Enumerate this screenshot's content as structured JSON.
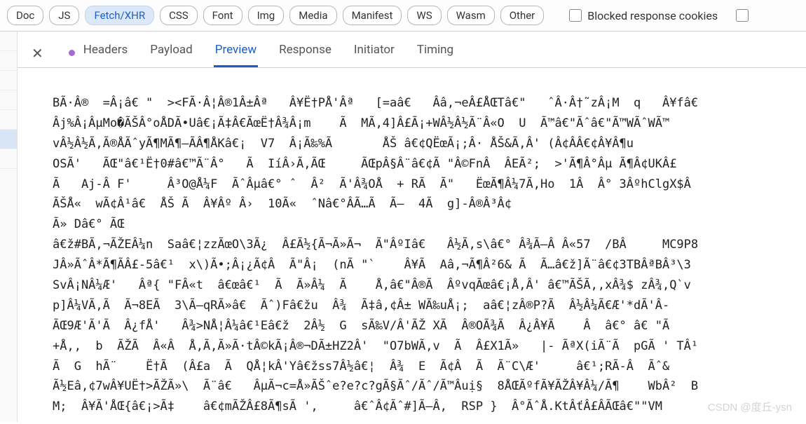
{
  "filters": {
    "items": [
      {
        "label": "Doc",
        "active": false
      },
      {
        "label": "JS",
        "active": false
      },
      {
        "label": "Fetch/XHR",
        "active": true
      },
      {
        "label": "CSS",
        "active": false
      },
      {
        "label": "Font",
        "active": false
      },
      {
        "label": "Img",
        "active": false
      },
      {
        "label": "Media",
        "active": false
      },
      {
        "label": "Manifest",
        "active": false
      },
      {
        "label": "WS",
        "active": false
      },
      {
        "label": "Wasm",
        "active": false
      },
      {
        "label": "Other",
        "active": false
      }
    ],
    "blocked_cookies_label": "Blocked response cookies"
  },
  "tabs": {
    "items": [
      {
        "label": "Headers",
        "active": false
      },
      {
        "label": "Payload",
        "active": false
      },
      {
        "label": "Preview",
        "active": true
      },
      {
        "label": "Response",
        "active": false
      },
      {
        "label": "Initiator",
        "active": false
      },
      {
        "label": "Timing",
        "active": false
      }
    ]
  },
  "preview": {
    "lines": [
      "BÃ·Â®  =Â¡â€ \"  ><FÃ·Â¦Â®1Â±Âª   Â¥Ë†PÅ'Âª   [=aâ€   Ââ,¬eÂ£ÅŒTâ€\"   ˆÂ·Â†˜zÂ¡M  q   Â¥fâ€",
      "Âj%Â¡ÂµMo�ÃŠÂ°oÅDÃ•Uâ€¡Ã‡Â€ÃœË†Â¾Â¡m    Ã  MÃ,4]Â£Ã¡+WÂ½Â½Ã¨Â«O  U  Ã™â€\"Ãˆâ€\"Ã™WÃˆWÃ™",
      "vÂ½Â½Ã,Ã®ÅÃˆyÃ¶MÃ¶–ÃÂ¶ÅKâ€¡  V7  Â¡Ã‰%Ã       ÅŠ â€¢QËœÃ¡;Â· ÅŠ&Ã,Â' (Â¢ÂÂ€¢Â¥Â¶u",
      "OSÃ'   ÃŒ\"â€¹Ë†0#â€™Ã¨Â°   Ã  IíÂ›Ã,ÃŒ     ÃŒpÂ§Â¨â€¢Ã \"Â©FnÂ  ÂEÃ²;  >'Ã¶Â°Âµ Ã¶Â¢UKÂ£",
      "Ã   Aj-Â F'     Â³O@Å¼F  ÃˆÂµâ€° ˆ  Â²  Ã'Â¾OÅ  + RÃ  Ã\"   ËœÃ¶Â¼7Ã,Ho  1Â  Â° 3ÂºhClgX$Â",
      "ÃŠÅ«  wÃ¢Â¹â€  ÅŠ Ã  Â¥Âº Â›  10Ã«  ˆNâ€°ÂÃ…Ã  Ã—  4Ã  g]-Â®Â³Â¢",
      "Ã» Dâ€° ÃŒ",
      "â€ž#BÃ,¬ÃŽEÂ¼n  Saâ€¦zzÃœO\\3Ã¿  Â£Ã½{Ã¬Ã»Ã¬  Ã\"ÂºIâ€   Â½Ã,s\\â€° Â¾Ã—Â Â«57  /BÂ     MC9P8",
      "JÂ»ÃˆÂ*Ã¶ÃÂ£-5â€¹  x\\)Ã•;Â¡¿Ã¢Â  Ã\"Â¡  (nÃ \"`    Â¥Ã  Aâ,¬Ã¶Â²6& Ã  Ã…â€ž]Ã¨â€¢3TBÂªBÂ³\\3",
      "SvÂ¡NÂ¼Æ'   Âª{ \"FÂ«t  â€œâ€¹  Ã  Ã»Â¼  Ã    Å,â€\"Â®Ã  ÂºvqÃœâ€¡Å,Â' â€™ÃŠÃ,,xÂ¾$ zÂ¾,Q`v",
      "p]Â¼VÃ,Ã  Ã¬8EÃ  3\\Ã–qRÃ»â€  Ãˆ)Fâ€žu  Â¾  Ã‡â,¢Â± WÃ‰uÅ¡;  aâ€¦zÂ®P?Ã  Â½Â¼Ã€Æ'*dÃ'Â-",
      "ÃŒ9Æ'Ã'Ã  Â¿fÅ'   Â¾>NÅ¦Â¼â€¹Eâ€ž  2Â½  G  sÃ‰V/Â'ÃŽ XÃ  Â®OÃ¾Ã  Â¿Â¥Ã    Â  â€° â€ \"Ã",
      "+Å,,  b  ÃŽÃ  Â«Â  Å,Ã,Ã»Ã·tÂ©kÃ¡Â®¬DÃ±HZ2Â'  \"O7bWÃ,v  Ã  Â£X1Ã»   |- ÃªX(iÃ¨Ã  pGÃ ' TÂ¹",
      "Ã  G  hÃ¨    Ë†Ã  (Â£a  Ã  QÅ¦kÂ'Yâ€žss7Â½â€¦  Â¾  E  Ã¢Â  Ã  Ã¨C\\Æ'     â€¹;RÃ-Â  Ãˆ&",
      "Ã½Eâ,¢7wÂ¥UË†>ÃŽÃ»\\  Ã¨â€   ÂµÃ¬c=Å»ÃŠˆe?e?c?gÃ§Ãˆ/Ãˆ/Ã™Âuị§  8ÅŒÃºfÃ¥ÃŽÂ¥Â¼/Ã¶    WbÂ²  B",
      "M;  Â¥Ã'ÅŒ{â€¡>Ã‡    â€¢mÃŽÂ£8Ã¶sÃ ',     â€ˆÂ¢Ãˆ#]Ã—Â,  RSP }  Â°ÃˆÅ.KtÂťÂ£ÂÃŒâ€\"\"VM"
    ]
  },
  "watermark": "CSDN @度丘-ysn"
}
